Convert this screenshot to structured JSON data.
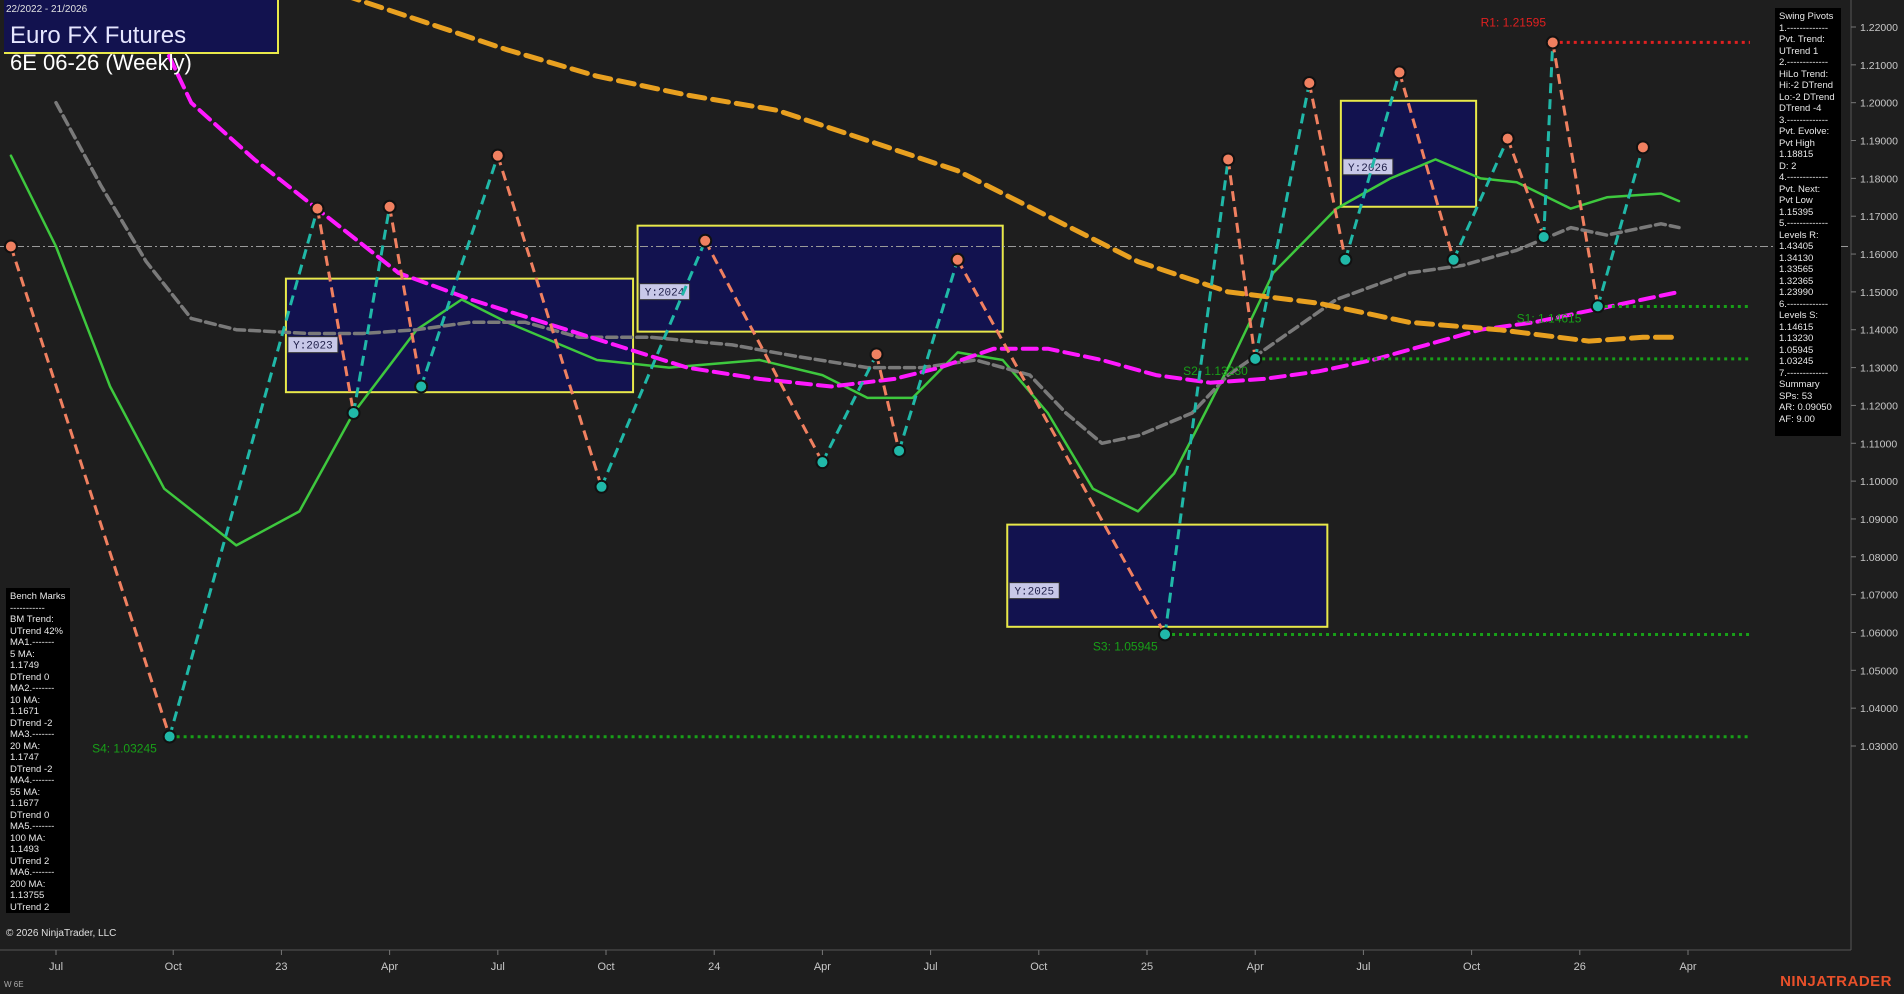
{
  "header": {
    "date_range": "22/2022 - 21/2026",
    "title": "Euro FX Futures",
    "subtitle": "6E 06-26 (Weekly)"
  },
  "swing_panel": {
    "lines": [
      "Swing Pivots",
      "1.-------------",
      "Pvt. Trend:",
      "UTrend 1",
      "2.-------------",
      "HiLo Trend:",
      "Hi:-2 DTrend",
      "Lo:-2 DTrend",
      "DTrend -4",
      "3.-------------",
      "Pvt. Evolve:",
      "Pvt High",
      "1.18815",
      "D: 2",
      "4.-------------",
      "Pvt. Next:",
      "Pvt Low",
      "1.15395",
      "5.-------------",
      "Levels R:",
      "1.43405",
      "1.34130",
      "1.33565",
      "1.32365",
      "1.23990",
      "6.-------------",
      "Levels S:",
      "1.14615",
      "1.13230",
      "1.05945",
      "1.03245",
      "7.-------------",
      "Summary",
      "SPs: 53",
      "AR: 0.09050",
      "AF: 9.00"
    ]
  },
  "bench_panel": {
    "lines": [
      "Bench Marks",
      "-----------",
      "BM Trend:",
      "UTrend 42%",
      "MA1.-------",
      "5 MA:",
      "1.1749",
      "DTrend 0",
      "MA2.-------",
      "10 MA:",
      "1.1671",
      "DTrend -2",
      "MA3.-------",
      "20 MA:",
      "1.1747",
      "DTrend -2",
      "MA4.-------",
      "55 MA:",
      "1.1677",
      "DTrend 0",
      "MA5.-------",
      "100 MA:",
      "1.1493",
      "UTrend 2",
      "MA6.-------",
      "200 MA:",
      "1.13755",
      "UTrend 2"
    ]
  },
  "footer": {
    "copyright": "© 2026 NinjaTrader, LLC",
    "brand": "NINJATRADER",
    "instrument_short": "W 6E"
  },
  "colors": {
    "background": "#1e1e1e",
    "zone_fill": "#12124f",
    "zone_border": "#e8e84a",
    "ma_green": "#3ec83e",
    "ma_gray": "#7a7a7a",
    "ma_magenta": "#ff19ff",
    "ma_orange": "#e8a020",
    "pivot_high": "#f08060",
    "pivot_low": "#20b8a8",
    "resistance": "#e02020",
    "support": "#18a018",
    "axis_text": "#c8c8c8"
  },
  "chart_data": {
    "type": "line",
    "ylim": [
      1.025,
      1.228
    ],
    "y_ticks": [
      "1.22000",
      "1.21000",
      "1.20000",
      "1.19000",
      "1.18000",
      "1.17000",
      "1.16000",
      "1.15000",
      "1.14000",
      "1.13000",
      "1.12000",
      "1.11000",
      "1.10000",
      "1.09000",
      "1.08000",
      "1.07000",
      "1.06000",
      "1.05000",
      "1.04000",
      "1.03000"
    ],
    "x_ticks": [
      {
        "label": "Jul",
        "t": 0.0
      },
      {
        "label": "Oct",
        "t": 0.13
      },
      {
        "label": "23",
        "t": 0.25
      },
      {
        "label": "Apr",
        "t": 0.37
      },
      {
        "label": "Jul",
        "t": 0.49
      },
      {
        "label": "Oct",
        "t": 0.61
      },
      {
        "label": "24",
        "t": 0.73
      },
      {
        "label": "Apr",
        "t": 0.85
      },
      {
        "label": "Jul",
        "t": 0.97
      },
      {
        "label": "Oct",
        "t": 1.09
      },
      {
        "label": "25",
        "t": 1.21
      },
      {
        "label": "Apr",
        "t": 1.33
      },
      {
        "label": "Jul",
        "t": 1.45
      },
      {
        "label": "Oct",
        "t": 1.57
      },
      {
        "label": "26",
        "t": 1.69
      },
      {
        "label": "Apr",
        "t": 1.81
      }
    ],
    "current_price_line": 1.162,
    "swing_pivots": [
      {
        "t": -0.05,
        "price": 1.162,
        "type": "high"
      },
      {
        "t": 0.126,
        "price": 1.0325,
        "type": "low"
      },
      {
        "t": 0.29,
        "price": 1.172,
        "type": "high"
      },
      {
        "t": 0.33,
        "price": 1.118,
        "type": "low"
      },
      {
        "t": 0.37,
        "price": 1.1725,
        "type": "high"
      },
      {
        "t": 0.405,
        "price": 1.125,
        "type": "low"
      },
      {
        "t": 0.49,
        "price": 1.186,
        "type": "high"
      },
      {
        "t": 0.605,
        "price": 1.0985,
        "type": "low"
      },
      {
        "t": 0.72,
        "price": 1.1635,
        "type": "high"
      },
      {
        "t": 0.85,
        "price": 1.105,
        "type": "low"
      },
      {
        "t": 0.91,
        "price": 1.1335,
        "type": "high"
      },
      {
        "t": 0.935,
        "price": 1.108,
        "type": "low"
      },
      {
        "t": 1.0,
        "price": 1.1585,
        "type": "high"
      },
      {
        "t": 1.23,
        "price": 1.0595,
        "type": "low"
      },
      {
        "t": 1.3,
        "price": 1.185,
        "type": "high"
      },
      {
        "t": 1.33,
        "price": 1.1323,
        "type": "low"
      },
      {
        "t": 1.39,
        "price": 1.2052,
        "type": "high"
      },
      {
        "t": 1.43,
        "price": 1.1585,
        "type": "low"
      },
      {
        "t": 1.49,
        "price": 1.208,
        "type": "high"
      },
      {
        "t": 1.55,
        "price": 1.1585,
        "type": "low"
      },
      {
        "t": 1.61,
        "price": 1.1905,
        "type": "high"
      },
      {
        "t": 1.65,
        "price": 1.1645,
        "type": "low"
      },
      {
        "t": 1.66,
        "price": 1.2159,
        "type": "high"
      },
      {
        "t": 1.71,
        "price": 1.1462,
        "type": "low"
      },
      {
        "t": 1.76,
        "price": 1.1882,
        "type": "high"
      }
    ],
    "levels": [
      {
        "label": "R1: 1.21595",
        "price": 1.21595,
        "kind": "resistance",
        "t_start": 1.66,
        "label_t": 1.58
      },
      {
        "label": "S1: 1.14615",
        "price": 1.14615,
        "kind": "support",
        "t_start": 1.71,
        "label_t": 1.62
      },
      {
        "label": "S2: 1.13230",
        "price": 1.1323,
        "kind": "support",
        "t_start": 1.33,
        "label_t": 1.25
      },
      {
        "label": "S3: 1.05945",
        "price": 1.05945,
        "kind": "support",
        "t_start": 1.23,
        "label_t": 1.15
      },
      {
        "label": "S4: 1.03245",
        "price": 1.03245,
        "kind": "support",
        "t_start": 0.126,
        "label_t": 0.04
      }
    ],
    "zones": [
      {
        "label": "Y:2023",
        "t0": 0.255,
        "t1": 0.64,
        "top": 1.1535,
        "bottom": 1.1235
      },
      {
        "label": "Y:2024",
        "t0": 0.645,
        "t1": 1.05,
        "top": 1.1675,
        "bottom": 1.1395
      },
      {
        "label": "Y:2025",
        "t0": 1.055,
        "t1": 1.41,
        "top": 1.0885,
        "bottom": 1.0615
      },
      {
        "label": "Y:2026",
        "t0": 1.425,
        "t1": 1.575,
        "top": 1.2005,
        "bottom": 1.1725
      }
    ],
    "moving_averages": [
      {
        "name": "5 MA",
        "color": "#3ec83e",
        "points": [
          [
            -0.05,
            1.186
          ],
          [
            0.0,
            1.162
          ],
          [
            0.06,
            1.125
          ],
          [
            0.12,
            1.098
          ],
          [
            0.2,
            1.083
          ],
          [
            0.27,
            1.092
          ],
          [
            0.33,
            1.118
          ],
          [
            0.4,
            1.14
          ],
          [
            0.45,
            1.148
          ],
          [
            0.5,
            1.142
          ],
          [
            0.6,
            1.132
          ],
          [
            0.68,
            1.13
          ],
          [
            0.78,
            1.132
          ],
          [
            0.85,
            1.128
          ],
          [
            0.9,
            1.122
          ],
          [
            0.95,
            1.122
          ],
          [
            1.0,
            1.134
          ],
          [
            1.05,
            1.132
          ],
          [
            1.1,
            1.118
          ],
          [
            1.15,
            1.098
          ],
          [
            1.2,
            1.092
          ],
          [
            1.24,
            1.102
          ],
          [
            1.3,
            1.13
          ],
          [
            1.35,
            1.155
          ],
          [
            1.42,
            1.172
          ],
          [
            1.48,
            1.18
          ],
          [
            1.53,
            1.185
          ],
          [
            1.58,
            1.18
          ],
          [
            1.62,
            1.179
          ],
          [
            1.68,
            1.172
          ],
          [
            1.72,
            1.175
          ],
          [
            1.78,
            1.176
          ],
          [
            1.8,
            1.174
          ]
        ]
      },
      {
        "name": "20 MA",
        "color": "#7a7a7a",
        "points": [
          [
            0.0,
            1.2
          ],
          [
            0.05,
            1.178
          ],
          [
            0.1,
            1.158
          ],
          [
            0.15,
            1.143
          ],
          [
            0.2,
            1.14
          ],
          [
            0.28,
            1.139
          ],
          [
            0.34,
            1.139
          ],
          [
            0.4,
            1.14
          ],
          [
            0.46,
            1.142
          ],
          [
            0.52,
            1.142
          ],
          [
            0.58,
            1.138
          ],
          [
            0.66,
            1.138
          ],
          [
            0.75,
            1.136
          ],
          [
            0.82,
            1.133
          ],
          [
            0.9,
            1.13
          ],
          [
            0.96,
            1.13
          ],
          [
            1.02,
            1.132
          ],
          [
            1.08,
            1.128
          ],
          [
            1.12,
            1.118
          ],
          [
            1.16,
            1.11
          ],
          [
            1.2,
            1.112
          ],
          [
            1.26,
            1.118
          ],
          [
            1.3,
            1.128
          ],
          [
            1.36,
            1.138
          ],
          [
            1.42,
            1.148
          ],
          [
            1.5,
            1.155
          ],
          [
            1.56,
            1.157
          ],
          [
            1.62,
            1.161
          ],
          [
            1.68,
            1.167
          ],
          [
            1.72,
            1.165
          ],
          [
            1.78,
            1.168
          ],
          [
            1.8,
            1.167
          ]
        ]
      },
      {
        "name": "55 MA",
        "color": "#ff19ff",
        "points": [
          [
            0.0,
            1.29
          ],
          [
            0.05,
            1.255
          ],
          [
            0.1,
            1.225
          ],
          [
            0.15,
            1.2
          ],
          [
            0.22,
            1.185
          ],
          [
            0.3,
            1.17
          ],
          [
            0.38,
            1.155
          ],
          [
            0.46,
            1.148
          ],
          [
            0.54,
            1.142
          ],
          [
            0.62,
            1.136
          ],
          [
            0.7,
            1.13
          ],
          [
            0.78,
            1.127
          ],
          [
            0.86,
            1.125
          ],
          [
            0.93,
            1.127
          ],
          [
            0.98,
            1.13
          ],
          [
            1.04,
            1.135
          ],
          [
            1.1,
            1.135
          ],
          [
            1.16,
            1.132
          ],
          [
            1.22,
            1.128
          ],
          [
            1.28,
            1.126
          ],
          [
            1.34,
            1.127
          ],
          [
            1.4,
            1.129
          ],
          [
            1.46,
            1.132
          ],
          [
            1.52,
            1.136
          ],
          [
            1.58,
            1.14
          ],
          [
            1.64,
            1.142
          ],
          [
            1.7,
            1.145
          ],
          [
            1.76,
            1.148
          ],
          [
            1.8,
            1.15
          ]
        ]
      },
      {
        "name": "100 MA",
        "color": "#e8a020",
        "points": [
          [
            0.0,
            1.26
          ],
          [
            0.1,
            1.252
          ],
          [
            0.2,
            1.24
          ],
          [
            0.3,
            1.23
          ],
          [
            0.4,
            1.222
          ],
          [
            0.5,
            1.214
          ],
          [
            0.6,
            1.207
          ],
          [
            0.7,
            1.202
          ],
          [
            0.8,
            1.198
          ],
          [
            0.9,
            1.19
          ],
          [
            1.0,
            1.182
          ],
          [
            1.1,
            1.17
          ],
          [
            1.2,
            1.158
          ],
          [
            1.3,
            1.15
          ],
          [
            1.4,
            1.147
          ],
          [
            1.5,
            1.142
          ],
          [
            1.6,
            1.14
          ],
          [
            1.7,
            1.137
          ],
          [
            1.76,
            1.138
          ],
          [
            1.8,
            1.138
          ]
        ]
      }
    ]
  }
}
